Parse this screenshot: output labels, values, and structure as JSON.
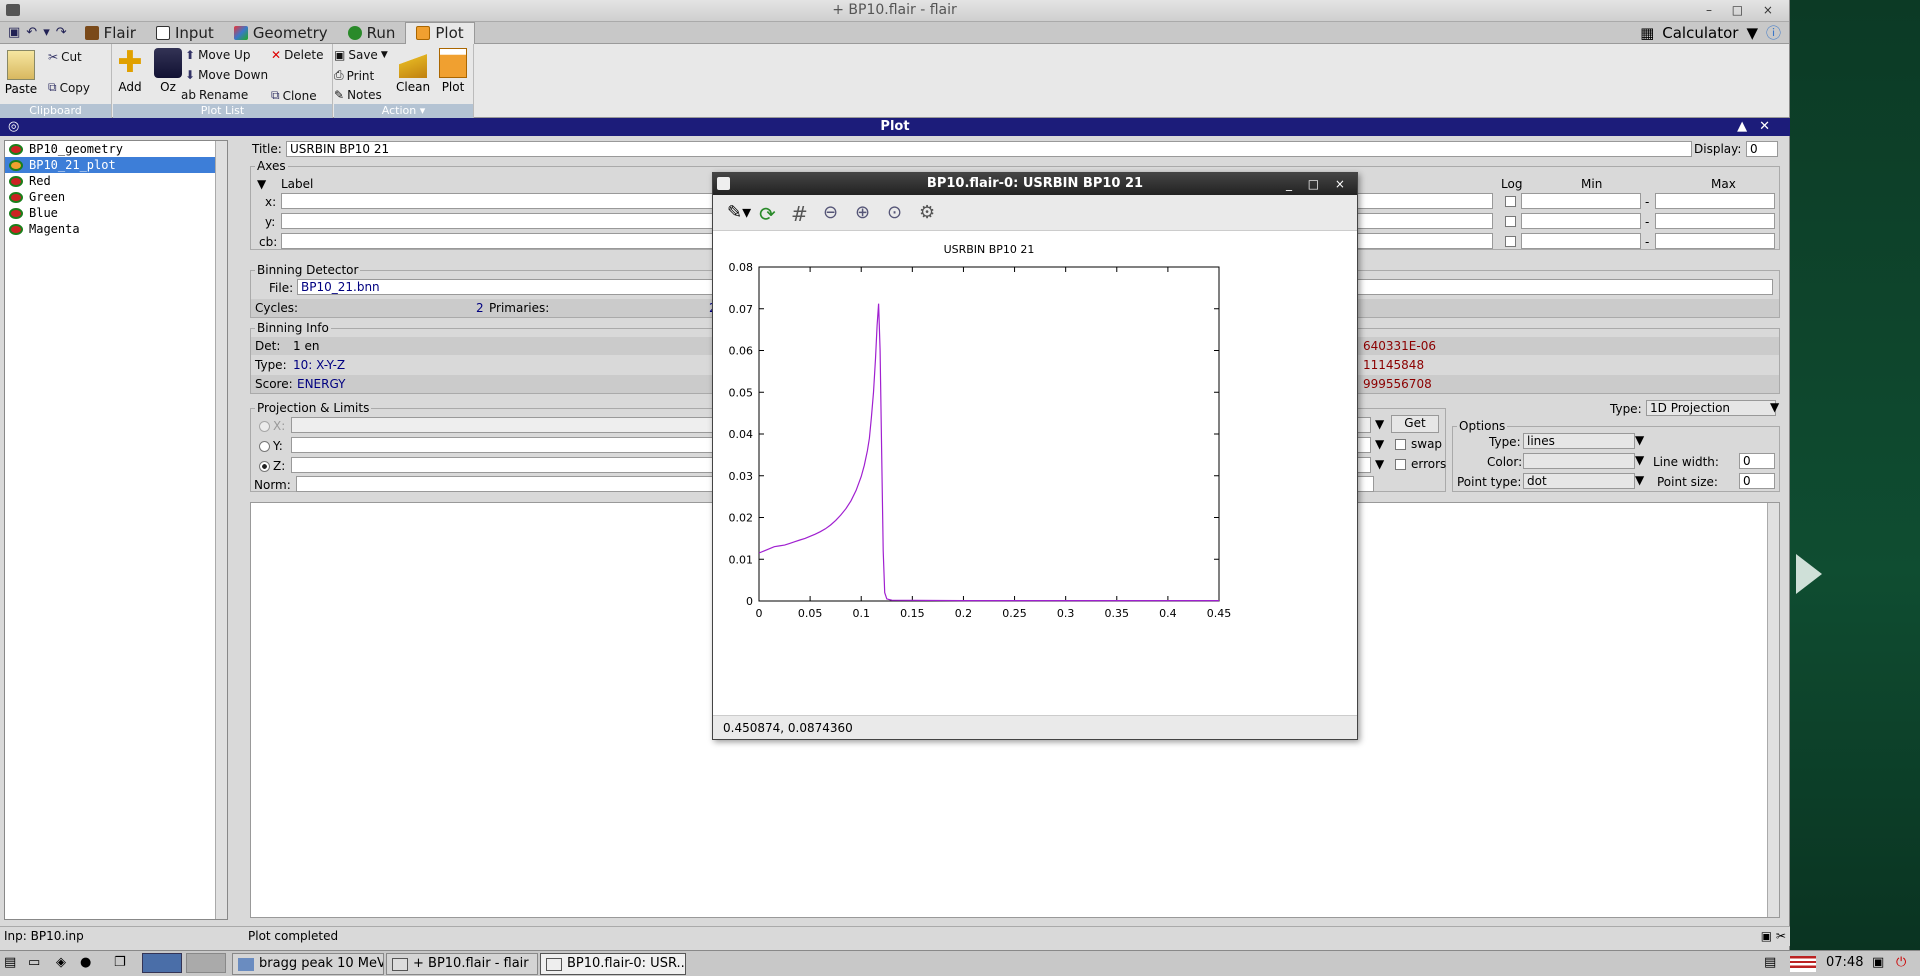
{
  "window": {
    "title": "+ BP10.flair - flair",
    "controls": "– □ ×"
  },
  "tabs": [
    {
      "label": "Flair",
      "color": "#7a4a1a"
    },
    {
      "label": "Input",
      "color": "#333333"
    },
    {
      "label": "Geometry",
      "color": "#3a77c9"
    },
    {
      "label": "Run",
      "color": "#2a8a2a"
    },
    {
      "label": "Plot",
      "color": "#c46a00"
    }
  ],
  "calculator": {
    "label": "Calculator"
  },
  "ribbon": {
    "clipboard": {
      "label": "Clipboard",
      "paste": "Paste",
      "cut": "Cut",
      "copy": "Copy"
    },
    "plotlist": {
      "label": "Plot List",
      "add": "Add",
      "oz": "Oz",
      "move_up": "Move Up",
      "move_down": "Move Down",
      "rename": "Rename",
      "delete": "Delete",
      "clone": "Clone"
    },
    "action": {
      "label": "Action",
      "save": "Save",
      "print": "Print",
      "notes": "Notes",
      "clean": "Clean",
      "plot": "Plot"
    }
  },
  "panel": {
    "title": "Plot"
  },
  "plot_list": [
    {
      "label": "BP10_geometry",
      "selected": false
    },
    {
      "label": "BP10_21_plot",
      "selected": true
    },
    {
      "label": "Red",
      "selected": false
    },
    {
      "label": "Green",
      "selected": false
    },
    {
      "label": "Blue",
      "selected": false
    },
    {
      "label": "Magenta",
      "selected": false
    }
  ],
  "form": {
    "title_label": "Title:",
    "title_value": "USRBIN BP10 21",
    "display_label": "Display:",
    "display_value": "0",
    "axes_label": "Axes",
    "axes_col_label": "Label",
    "axes_col_log": "Log",
    "axes_col_min": "Min",
    "axes_col_max": "Max",
    "axis_x": "x:",
    "axis_y": "y:",
    "axis_cb": "cb:",
    "dash": "-",
    "binning_detector": "Binning Detector",
    "file_label": "File:",
    "file_value": "BP10_21.bnn",
    "cycles_label": "Cycles:",
    "cycles_value": "2",
    "primaries_label": "Primaries:",
    "primaries_value": "2(",
    "binning_info": "Binning Info",
    "det_label": "Det:",
    "det_value": "1 en",
    "type_label": "Type:",
    "type_value": "10: X-Y-Z",
    "score_label": "Score:",
    "score_value": "ENERGY",
    "info_val1": "640331E-06",
    "info_val2": "11145848",
    "info_val3": "999556708",
    "proj_limits": "Projection & Limits",
    "proj_type_label": "Type:",
    "proj_type_value": "1D Projection",
    "rx": "X:",
    "ry": "Y:",
    "rz": "Z:",
    "norm": "Norm:",
    "get": "Get",
    "swap": "swap",
    "errors": "errors",
    "options": "Options",
    "opt_type_label": "Type:",
    "opt_type_value": "lines",
    "opt_color_label": "Color:",
    "opt_lw_label": "Line width:",
    "opt_lw_value": "0",
    "opt_pt_label": "Point type:",
    "opt_pt_value": "dot",
    "opt_ps_label": "Point size:",
    "opt_ps_value": "0"
  },
  "status": {
    "left": "Inp: BP10.inp",
    "right": "Plot completed"
  },
  "plot_window": {
    "title": "BP10.flair-0: USRBIN BP10 21",
    "controls": "_ □ ×",
    "coords": "0.450874,  0.0874360"
  },
  "chart_data": {
    "type": "line",
    "title": "USRBIN BP10 21",
    "xlabel": "",
    "ylabel": "",
    "xlim": [
      0,
      0.45
    ],
    "ylim": [
      0,
      0.08
    ],
    "xticks": [
      "0",
      "0.05",
      "0.1",
      "0.15",
      "0.2",
      "0.25",
      "0.3",
      "0.35",
      "0.4",
      "0.45"
    ],
    "yticks": [
      "0",
      "0.01",
      "0.02",
      "0.03",
      "0.04",
      "0.05",
      "0.06",
      "0.07",
      "0.08"
    ],
    "grid": false,
    "series": [
      {
        "color": "#a020d0",
        "x": [
          0,
          0.005,
          0.01,
          0.015,
          0.02,
          0.025,
          0.03,
          0.035,
          0.04,
          0.045,
          0.05,
          0.055,
          0.06,
          0.065,
          0.07,
          0.075,
          0.08,
          0.085,
          0.09,
          0.095,
          0.1,
          0.103,
          0.106,
          0.108,
          0.11,
          0.112,
          0.114,
          0.1155,
          0.117,
          0.1185,
          0.12,
          0.1215,
          0.123,
          0.125,
          0.13,
          0.2,
          0.3,
          0.4,
          0.45
        ],
        "y": [
          0.0115,
          0.012,
          0.0125,
          0.013,
          0.0132,
          0.0134,
          0.0138,
          0.0142,
          0.0146,
          0.015,
          0.0155,
          0.016,
          0.0166,
          0.0173,
          0.0182,
          0.0193,
          0.0206,
          0.0221,
          0.024,
          0.0265,
          0.0298,
          0.0325,
          0.036,
          0.039,
          0.044,
          0.05,
          0.058,
          0.066,
          0.0712,
          0.06,
          0.035,
          0.012,
          0.002,
          0.0005,
          0.0002,
          0.0001,
          0.0001,
          0.0001,
          0.0001
        ]
      }
    ]
  },
  "taskbar": {
    "items": [
      {
        "label": "bragg peak 10 MeV"
      },
      {
        "label": "+ BP10.flair - flair"
      },
      {
        "label": "BP10.flair-0: USR..."
      }
    ],
    "clock": "07:48"
  }
}
